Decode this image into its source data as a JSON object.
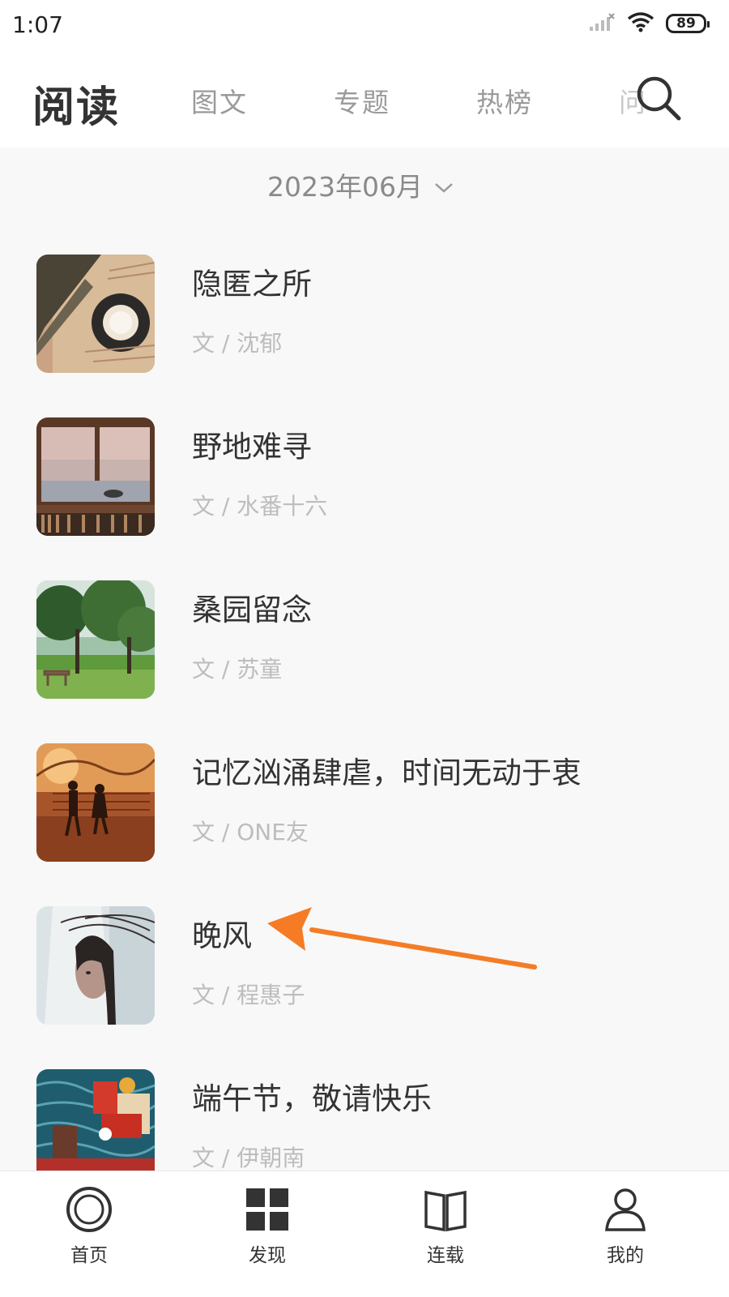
{
  "status": {
    "time": "1:07",
    "battery": "89",
    "icons": [
      "signal-icon",
      "wifi-icon",
      "battery-icon"
    ]
  },
  "header": {
    "title": "阅读",
    "tabs": [
      {
        "label": "图文"
      },
      {
        "label": "专题"
      },
      {
        "label": "热榜"
      },
      {
        "label": "问"
      }
    ],
    "search_icon": "search-icon"
  },
  "month_selector": {
    "label": "2023年06月",
    "icon": "chevron-down-icon"
  },
  "articles": [
    {
      "title": "隐匿之所",
      "author": "文 / 沈郁",
      "thumb": "teacup-on-book"
    },
    {
      "title": "野地难寻",
      "author": "文 / 水番十六",
      "thumb": "window-sea-view"
    },
    {
      "title": "桑园留念",
      "author": "文 / 苏童",
      "thumb": "garden-trees"
    },
    {
      "title": "记忆汹涌肆虐，时间无动于衷",
      "author": "文 / ONE友",
      "thumb": "couple-sunset"
    },
    {
      "title": "晚风",
      "author": "文 / 程惠子",
      "thumb": "girl-wind"
    },
    {
      "title": "端午节，敬请快乐",
      "author": "文 / 伊朝南",
      "thumb": "dragon-boat"
    }
  ],
  "colors": {
    "arrow": "#f57c25",
    "background": "#f8f8f8",
    "title_text": "#333333",
    "author_text": "#bdbdbd"
  },
  "bottom_nav": [
    {
      "label": "首页",
      "icon": "home-circle-icon"
    },
    {
      "label": "发现",
      "icon": "grid-icon"
    },
    {
      "label": "连载",
      "icon": "book-icon"
    },
    {
      "label": "我的",
      "icon": "person-icon"
    }
  ]
}
